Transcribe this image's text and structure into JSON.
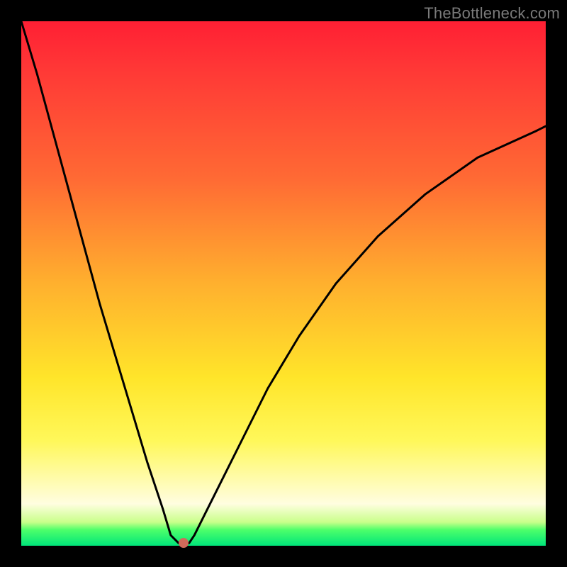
{
  "watermark": "TheBottleneck.com",
  "colors": {
    "frame": "#000000",
    "curve_stroke": "#000000",
    "marker": "#d06a5a",
    "gradient_top": "#ff1f34",
    "gradient_mid1": "#ffb02e",
    "gradient_mid2": "#ffe52a",
    "gradient_bottom": "#00e57a"
  },
  "chart_data": {
    "type": "line",
    "title": "",
    "xlabel": "",
    "ylabel": "",
    "xlim": [
      0,
      100
    ],
    "ylim": [
      0,
      100
    ],
    "grid": false,
    "series": [
      {
        "name": "bottleneck-curve",
        "x": [
          0,
          3,
          6,
          9,
          12,
          15,
          18,
          21,
          24,
          27,
          28.5,
          30,
          31,
          32,
          33,
          35,
          38,
          42,
          47,
          53,
          60,
          68,
          77,
          87,
          98,
          100
        ],
        "y": [
          100,
          90,
          79,
          68,
          57,
          46,
          36,
          26,
          16,
          7,
          2,
          0.5,
          0.2,
          0.5,
          2,
          6,
          12,
          20,
          30,
          40,
          50,
          59,
          67,
          74,
          79,
          80
        ]
      }
    ],
    "annotations": [
      {
        "name": "optimal-marker",
        "x": 31,
        "y": 0.5
      }
    ]
  }
}
